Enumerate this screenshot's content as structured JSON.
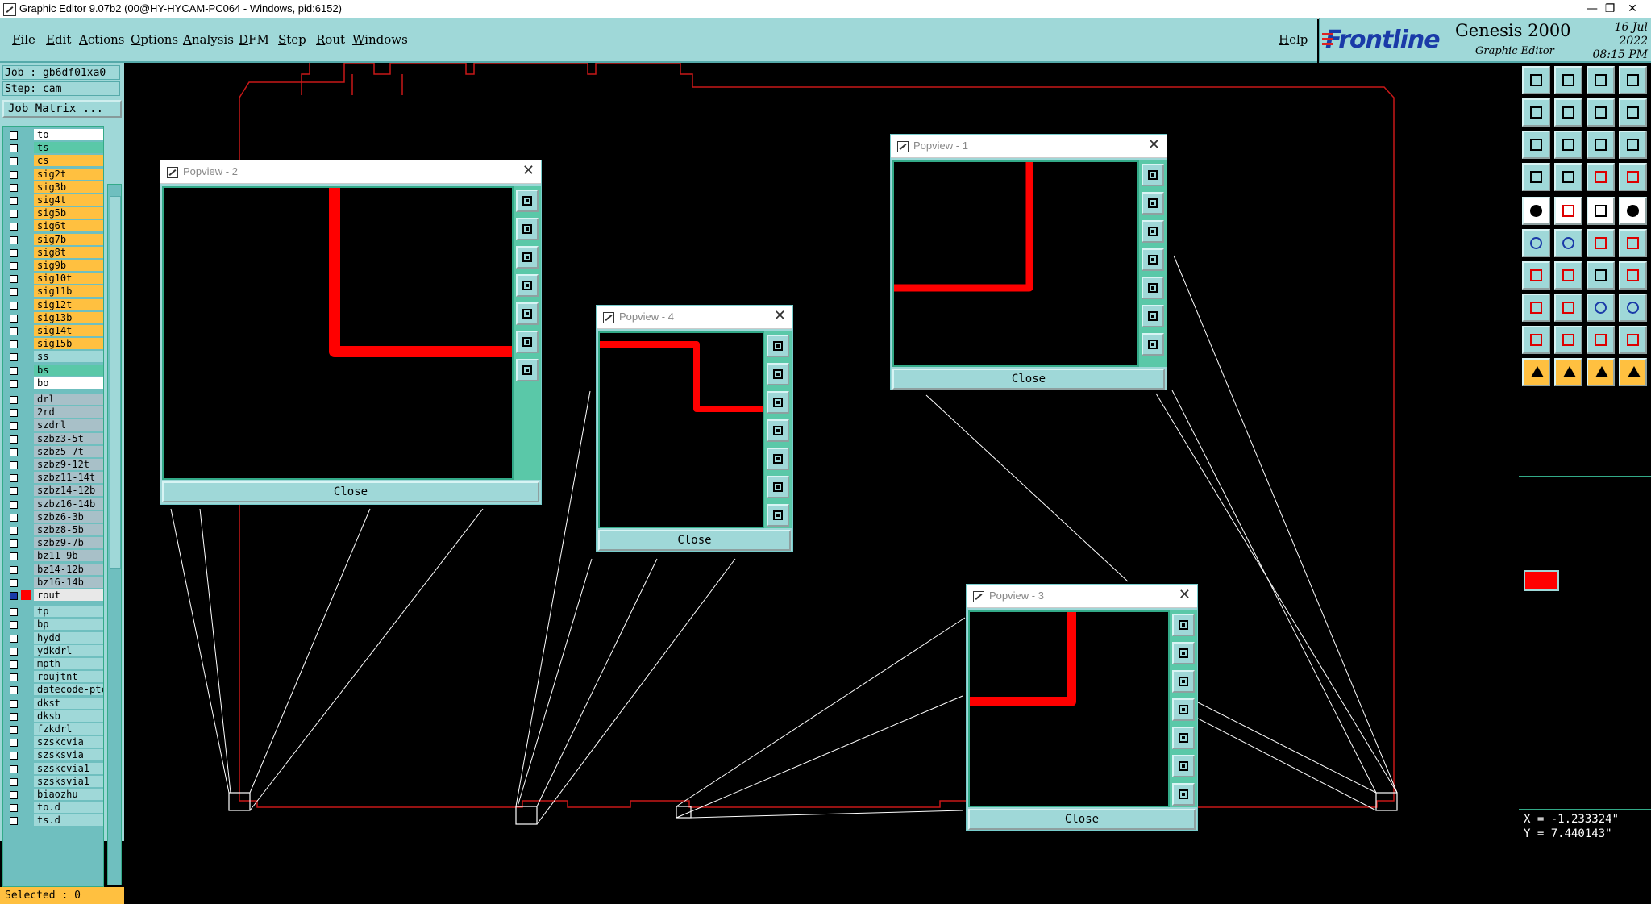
{
  "window": {
    "title": "Graphic Editor 9.07b2 (00@HY-HYCAM-PC064 - Windows, pid:6152)",
    "minimize": "—",
    "restore": "❐",
    "close": "✕"
  },
  "menu": {
    "items": [
      "File",
      "Edit",
      "Actions",
      "Options",
      "Analysis",
      "DFM",
      "Step",
      "Rout",
      "Windows"
    ],
    "help": "Help"
  },
  "brand": {
    "logo": "Frontline",
    "product": "Genesis 2000",
    "subtitle": "Graphic Editor",
    "date": "16 Jul 2022",
    "time": "08:15 PM"
  },
  "job": {
    "job_label": "Job : gb6df01xa0",
    "step_label": "Step: cam",
    "matrix_button": "Job Matrix ..."
  },
  "layers": [
    {
      "name": "to",
      "color": "#ffffff",
      "group": 1
    },
    {
      "name": "ts",
      "color": "#5ac8a8",
      "group": 1
    },
    {
      "name": "cs",
      "color": "#ffc040",
      "group": 1
    },
    {
      "name": "sig2t",
      "color": "#ffc040",
      "group": 1
    },
    {
      "name": "sig3b",
      "color": "#ffc040",
      "group": 1
    },
    {
      "name": "sig4t",
      "color": "#ffc040",
      "group": 1
    },
    {
      "name": "sig5b",
      "color": "#ffc040",
      "group": 1
    },
    {
      "name": "sig6t",
      "color": "#ffc040",
      "group": 1
    },
    {
      "name": "sig7b",
      "color": "#ffc040",
      "group": 1
    },
    {
      "name": "sig8t",
      "color": "#ffc040",
      "group": 1
    },
    {
      "name": "sig9b",
      "color": "#ffc040",
      "group": 1
    },
    {
      "name": "sig10t",
      "color": "#ffc040",
      "group": 1
    },
    {
      "name": "sig11b",
      "color": "#ffc040",
      "group": 1
    },
    {
      "name": "sig12t",
      "color": "#ffc040",
      "group": 1
    },
    {
      "name": "sig13b",
      "color": "#ffc040",
      "group": 1
    },
    {
      "name": "sig14t",
      "color": "#ffc040",
      "group": 1
    },
    {
      "name": "sig15b",
      "color": "#ffc040",
      "group": 1
    },
    {
      "name": "ss",
      "color": "#9fd8d8",
      "group": 1
    },
    {
      "name": "bs",
      "color": "#5ac8a8",
      "group": 1
    },
    {
      "name": "bo",
      "color": "#ffffff",
      "group": 1
    },
    {
      "name": "drl",
      "color": "#a8c0c8",
      "group": 2
    },
    {
      "name": "2rd",
      "color": "#a8c0c8",
      "group": 2
    },
    {
      "name": "szdrl",
      "color": "#a8c0c8",
      "group": 2
    },
    {
      "name": "szbz3-5t",
      "color": "#a8c0c8",
      "group": 2
    },
    {
      "name": "szbz5-7t",
      "color": "#a8c0c8",
      "group": 2
    },
    {
      "name": "szbz9-12t",
      "color": "#a8c0c8",
      "group": 2
    },
    {
      "name": "szbz11-14t",
      "color": "#a8c0c8",
      "group": 2
    },
    {
      "name": "szbz14-12b",
      "color": "#a8c0c8",
      "group": 2
    },
    {
      "name": "szbz16-14b",
      "color": "#a8c0c8",
      "group": 2
    },
    {
      "name": "szbz6-3b",
      "color": "#a8c0c8",
      "group": 2
    },
    {
      "name": "szbz8-5b",
      "color": "#a8c0c8",
      "group": 2
    },
    {
      "name": "szbz9-7b",
      "color": "#a8c0c8",
      "group": 2
    },
    {
      "name": "bz11-9b",
      "color": "#a8c0c8",
      "group": 2
    },
    {
      "name": "bz14-12b",
      "color": "#a8c0c8",
      "group": 2
    },
    {
      "name": "bz16-14b",
      "color": "#a8c0c8",
      "group": 2
    },
    {
      "name": "rout",
      "color": "#e8e8e8",
      "group": 2,
      "active": true
    },
    {
      "name": "tp",
      "color": "#9fd8d8",
      "group": 3
    },
    {
      "name": "bp",
      "color": "#9fd8d8",
      "group": 3
    },
    {
      "name": "hydd",
      "color": "#9fd8d8",
      "group": 3
    },
    {
      "name": "ydkdrl",
      "color": "#9fd8d8",
      "group": 3
    },
    {
      "name": "mpth",
      "color": "#9fd8d8",
      "group": 3
    },
    {
      "name": "roujtnt",
      "color": "#9fd8d8",
      "group": 3
    },
    {
      "name": "datecode-ptc",
      "color": "#9fd8d8",
      "group": 3
    },
    {
      "name": "dkst",
      "color": "#9fd8d8",
      "group": 3
    },
    {
      "name": "dksb",
      "color": "#9fd8d8",
      "group": 3
    },
    {
      "name": "fzkdrl",
      "color": "#9fd8d8",
      "group": 3
    },
    {
      "name": "szskcvia",
      "color": "#9fd8d8",
      "group": 3
    },
    {
      "name": "szsksvia",
      "color": "#9fd8d8",
      "group": 3
    },
    {
      "name": "szskcvia1",
      "color": "#9fd8d8",
      "group": 3
    },
    {
      "name": "szsksvia1",
      "color": "#9fd8d8",
      "group": 3
    },
    {
      "name": "biaozhu",
      "color": "#9fd8d8",
      "group": 3
    },
    {
      "name": "to.d",
      "color": "#9fd8d8",
      "group": 3
    },
    {
      "name": "ts.d",
      "color": "#9fd8d8",
      "group": 3
    }
  ],
  "status": {
    "selected": "Selected : 0",
    "x": "X = -1.233324\"",
    "y": "Y = 7.440143\""
  },
  "popviews": [
    {
      "title": "Popview - 2",
      "close": "Close",
      "close_x": "✕"
    },
    {
      "title": "Popview - 4",
      "close": "Close",
      "close_x": "✕"
    },
    {
      "title": "Popview - 1",
      "close": "Close",
      "close_x": "✕"
    },
    {
      "title": "Popview - 3",
      "close": "Close",
      "close_x": "✕"
    }
  ],
  "colors": {
    "menu_bg": "#9fd8d8",
    "canvas_bg": "#000000",
    "board_outline": "#c81818",
    "trace": "#ff0000",
    "selected_bar": "#ffc040"
  }
}
